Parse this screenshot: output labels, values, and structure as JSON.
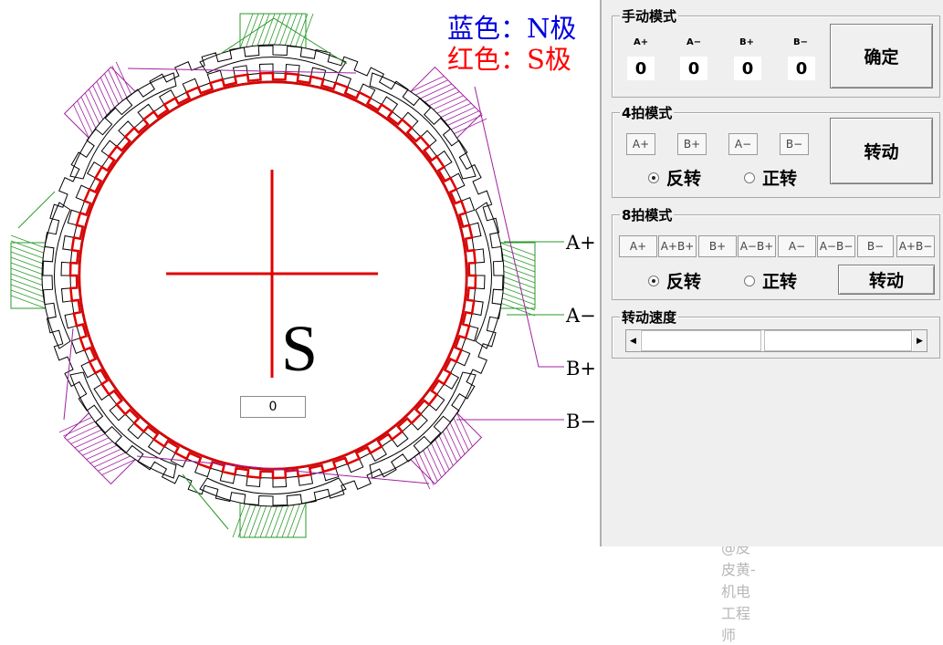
{
  "legend": {
    "n_pole": "蓝色：N极",
    "s_pole": "红色：S极",
    "n_color": "#0000e0",
    "s_color": "#ff0000"
  },
  "canvas": {
    "pole_letter": "S",
    "counter_value": "0",
    "phase_labels": {
      "a_plus": "A+",
      "a_minus": "A−",
      "b_plus": "B+",
      "b_minus": "B−"
    }
  },
  "manual_mode": {
    "title": "手动模式",
    "phases": [
      {
        "label": "A+",
        "value": "0"
      },
      {
        "label": "A−",
        "value": "0"
      },
      {
        "label": "B+",
        "value": "0"
      },
      {
        "label": "B−",
        "value": "0"
      }
    ],
    "confirm_label": "确定"
  },
  "four_beat": {
    "title": "4拍模式",
    "steps": [
      "A+",
      "B+",
      "A−",
      "B−"
    ],
    "reverse_label": "反转",
    "forward_label": "正转",
    "selected": "反转",
    "rotate_label": "转动"
  },
  "eight_beat": {
    "title": "8拍模式",
    "steps": [
      "A+",
      "A+B+",
      "B+",
      "A−B+",
      "A−",
      "A−B−",
      "B−",
      "A+B−"
    ],
    "reverse_label": "反转",
    "forward_label": "正转",
    "selected": "反转",
    "rotate_label": "转动"
  },
  "speed": {
    "title": "转动速度",
    "value_fraction": 0.46
  },
  "watermark": "CSDN @皮皮黄-机电工程师"
}
